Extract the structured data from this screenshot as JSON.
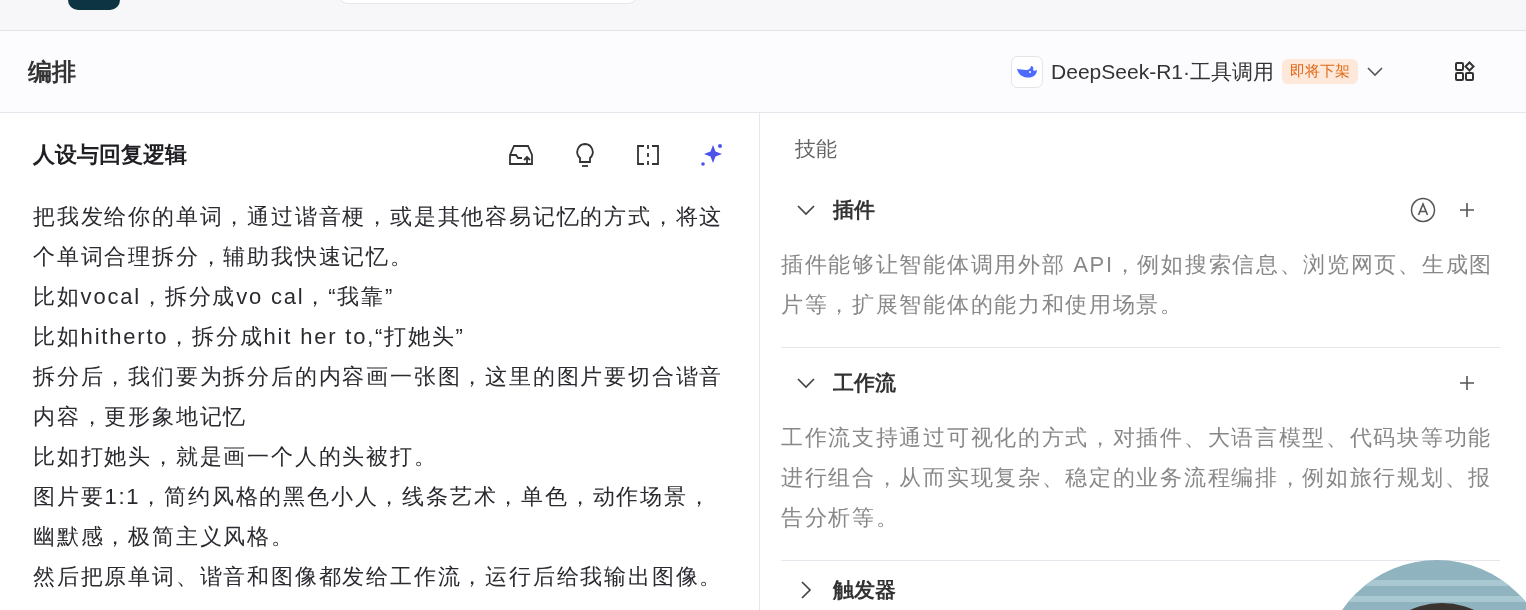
{
  "header": {
    "title": "编排",
    "model": {
      "name": "DeepSeek-R1·工具调用",
      "badge": "即将下架"
    }
  },
  "prompt_panel": {
    "title": "人设与回复逻辑",
    "paragraphs": [
      "把我发给你的单词，通过谐音梗，或是其他容易记忆的方式，将这个单词合理拆分，辅助我快速记忆。",
      "比如vocal，拆分成vo cal，“我靠”",
      "比如hitherto，拆分成hit her to,“打她头”",
      "拆分后，我们要为拆分后的内容画一张图，这里的图片要切合谐音内容，更形象地记忆",
      "比如打她头，就是画一个人的头被打。",
      "图片要1:1，简约风格的黑色小人，线条艺术，单色，动作场景，幽默感，极简主义风格。",
      "然后把原单词、谐音和图像都发给工作流，运行后给我输出图像。"
    ]
  },
  "skills": {
    "label": "技能",
    "sections": [
      {
        "title": "插件",
        "expanded": true,
        "auto": true,
        "addable": true,
        "description": "插件能够让智能体调用外部 API，例如搜索信息、浏览网页、生成图片等，扩展智能体的能力和使用场景。"
      },
      {
        "title": "工作流",
        "expanded": true,
        "auto": false,
        "addable": true,
        "description": "工作流支持通过可视化的方式，对插件、大语言模型、代码块等功能进行组合，从而实现复杂、稳定的业务流程编排，例如旅行规划、报告分析等。"
      },
      {
        "title": "触发器",
        "expanded": false
      }
    ]
  }
}
